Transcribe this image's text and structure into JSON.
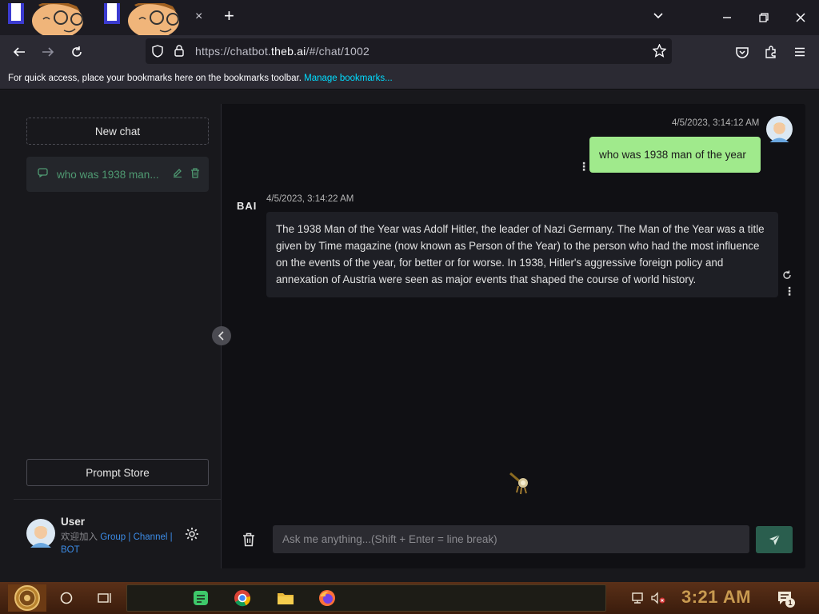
{
  "browser": {
    "tabs": [
      {
        "close_glyph": "×"
      }
    ],
    "new_tab_glyph": "+",
    "url_prefix": "https://chatbot.",
    "url_domain": "theb.ai",
    "url_suffix": "/#/chat/1002",
    "bookmarks_text": "For quick access, place your bookmarks here on the bookmarks toolbar.",
    "bookmarks_link": "Manage bookmarks..."
  },
  "sidebar": {
    "new_chat": "New chat",
    "chats": [
      {
        "title": "who was 1938 man..."
      }
    ],
    "prompt_store": "Prompt Store",
    "user": {
      "name": "User",
      "join_text": "欢迎加入",
      "link_group": "Group",
      "link_channel": "Channel",
      "link_bot": "BOT",
      "sep": "|"
    }
  },
  "chat": {
    "messages": [
      {
        "role": "user",
        "timestamp": "4/5/2023, 3:14:12 AM",
        "text": "who was 1938 man of the year"
      },
      {
        "role": "bot",
        "timestamp": "4/5/2023, 3:14:22 AM",
        "text": "The 1938 Man of the Year was Adolf Hitler, the leader of Nazi Germany. The Man of the Year was a title given by Time magazine (now known as Person of the Year) to the person who had the most influence on the events of the year, for better or for worse. In 1938, Hitler's aggressive foreign policy and annexation of Austria were seen as major events that shaped the course of world history."
      }
    ],
    "bot_logo": "BAI",
    "input_placeholder": "Ask me anything...(Shift + Enter = line break)"
  },
  "taskbar": {
    "clock": "3:21 AM",
    "notification_count": "1"
  },
  "colors": {
    "accent_green": "#4f9a72",
    "user_bubble": "#a0ea8c",
    "send_button": "#2a5e4e",
    "link_blue": "#3c8ce7",
    "clock_gold": "#c89a50"
  }
}
